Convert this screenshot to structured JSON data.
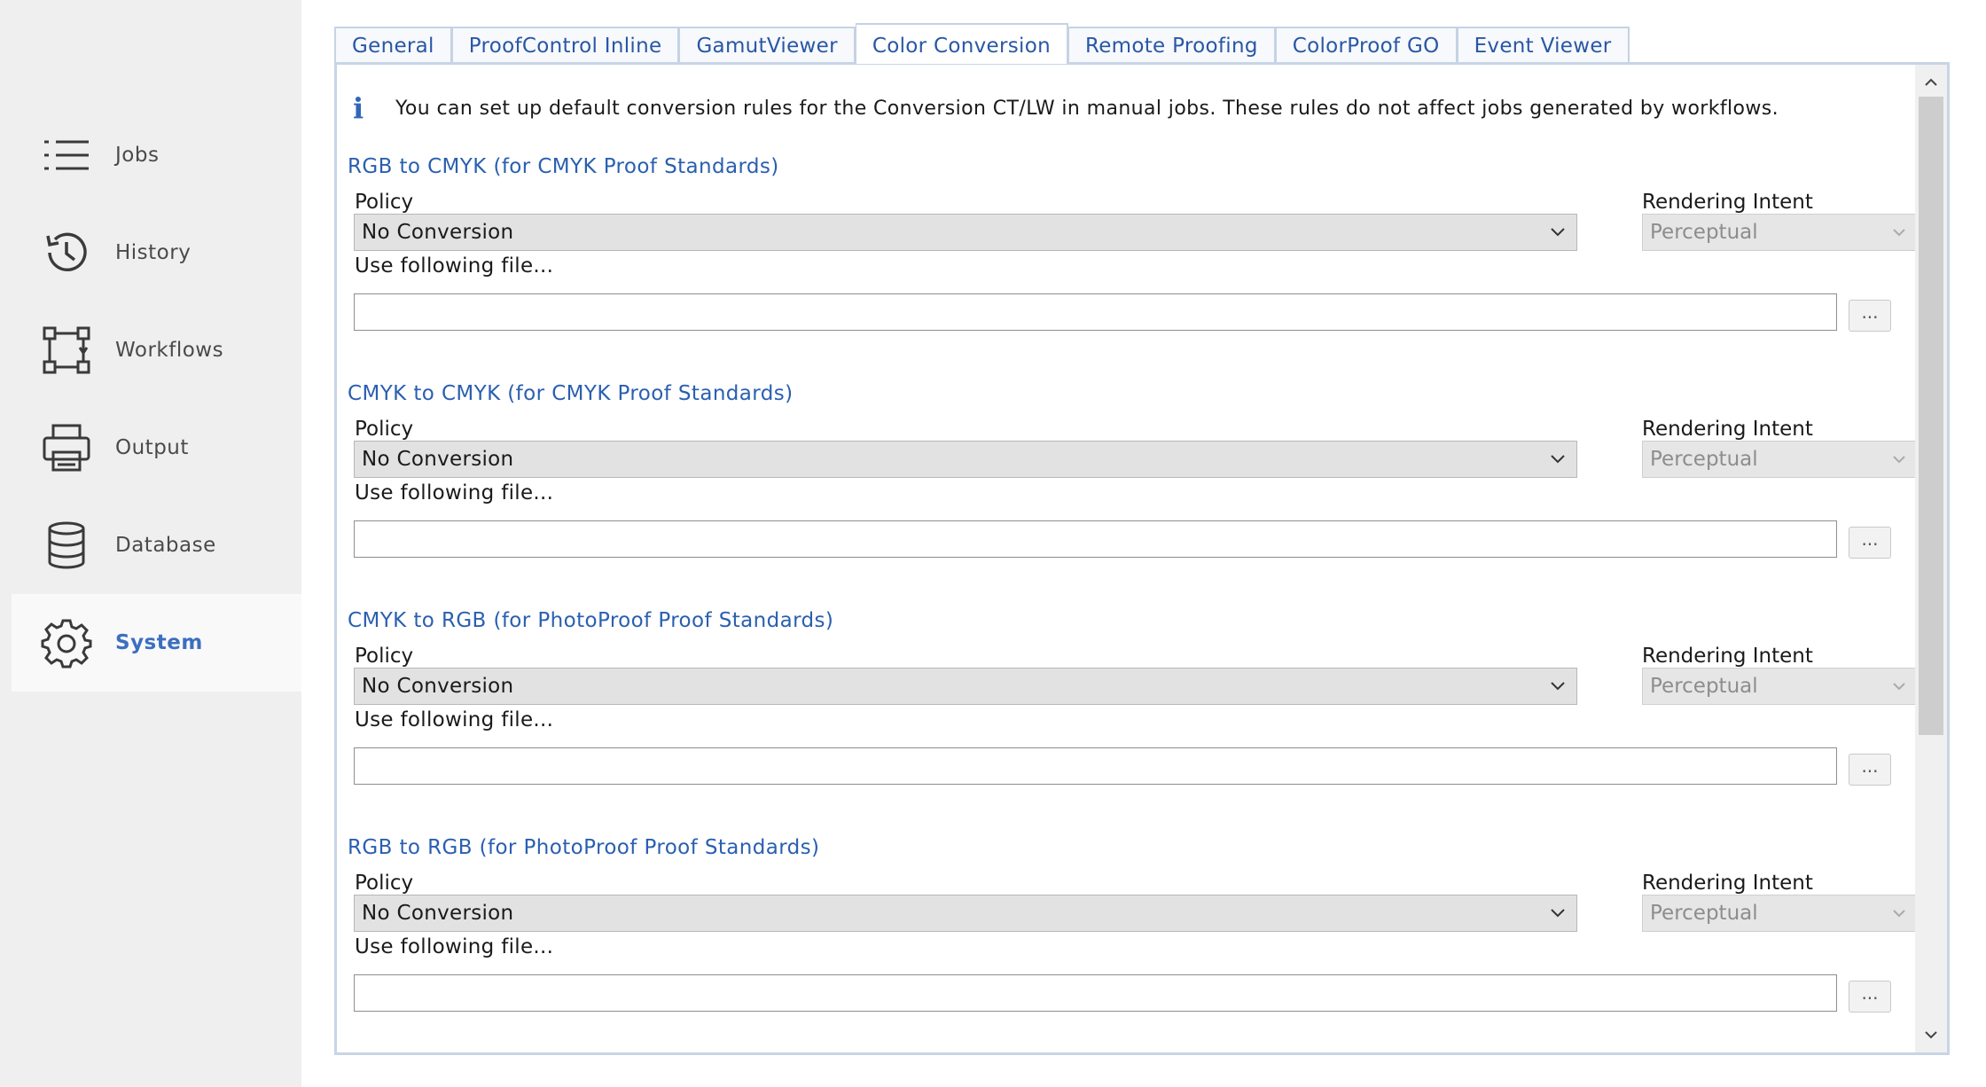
{
  "sidebar": {
    "items": [
      {
        "label": "Jobs",
        "icon": "list-icon"
      },
      {
        "label": "History",
        "icon": "history-icon"
      },
      {
        "label": "Workflows",
        "icon": "workflow-icon"
      },
      {
        "label": "Output",
        "icon": "printer-icon"
      },
      {
        "label": "Database",
        "icon": "database-icon"
      },
      {
        "label": "System",
        "icon": "gear-icon",
        "active": true
      }
    ]
  },
  "tabs": [
    {
      "label": "General"
    },
    {
      "label": "ProofControl Inline"
    },
    {
      "label": "GamutViewer"
    },
    {
      "label": "Color Conversion",
      "active": true
    },
    {
      "label": "Remote Proofing"
    },
    {
      "label": "ColorProof GO"
    },
    {
      "label": "Event Viewer"
    }
  ],
  "info": {
    "text": "You can set up default conversion rules for the Conversion CT/LW in manual jobs. These rules do not affect jobs generated by workflows."
  },
  "sections": [
    {
      "title": "RGB to CMYK (for CMYK Proof Standards)",
      "policy_label": "Policy",
      "policy_value": "No Conversion",
      "intent_label": "Rendering Intent",
      "intent_value": "Perceptual",
      "file_label": "Use following file...",
      "file_value": "",
      "browse_label": "..."
    },
    {
      "title": "CMYK to CMYK (for CMYK Proof Standards)",
      "policy_label": "Policy",
      "policy_value": "No Conversion",
      "intent_label": "Rendering Intent",
      "intent_value": "Perceptual",
      "file_label": "Use following file...",
      "file_value": "",
      "browse_label": "..."
    },
    {
      "title": "CMYK to RGB (for PhotoProof Proof Standards)",
      "policy_label": "Policy",
      "policy_value": "No Conversion",
      "intent_label": "Rendering Intent",
      "intent_value": "Perceptual",
      "file_label": "Use following file...",
      "file_value": "",
      "browse_label": "..."
    },
    {
      "title": "RGB to RGB (for PhotoProof Proof Standards)",
      "policy_label": "Policy",
      "policy_value": "No Conversion",
      "intent_label": "Rendering Intent",
      "intent_value": "Perceptual",
      "file_label": "Use following file...",
      "file_value": "",
      "browse_label": "..."
    }
  ],
  "colors": {
    "accent": "#2a5fb0",
    "tab_border": "#c5d3e3",
    "sidebar_bg": "#efefef"
  }
}
